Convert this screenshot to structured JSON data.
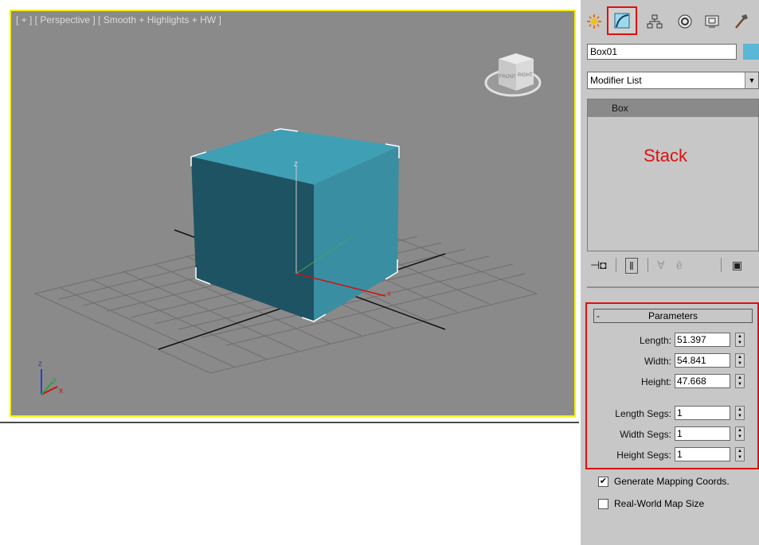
{
  "viewport": {
    "label": "[ + ] [ Perspective ] [ Smooth + Highlights + HW ]",
    "viewcube": {
      "front": "FRONT",
      "right": "RIGHT"
    },
    "axes": {
      "x": "x",
      "y": "y",
      "z": "z"
    },
    "colors": {
      "background": "#8a8a8a",
      "border": "#f6f000",
      "box_top": "#3f9fb5",
      "box_front": "#1e5363",
      "box_side": "#3a8ea2"
    }
  },
  "command_panel": {
    "tabs": [
      {
        "name": "create",
        "icon": "sun-star-icon"
      },
      {
        "name": "modify",
        "icon": "curve-modify-icon",
        "active": true
      },
      {
        "name": "hierarchy",
        "icon": "hierarchy-icon"
      },
      {
        "name": "motion",
        "icon": "motion-icon"
      },
      {
        "name": "display",
        "icon": "display-icon"
      },
      {
        "name": "utilities",
        "icon": "hammer-icon"
      }
    ],
    "object_name": "Box01",
    "object_color": "#5ab7d6",
    "modifier_list": "Modifier List",
    "stack_items": [
      "Box"
    ],
    "stack_annotation": "Stack",
    "stack_tools": [
      "pin-stack-icon",
      "show-end-result-icon",
      "make-unique-icon",
      "remove-modifier-icon",
      "configure-modifier-sets-icon"
    ],
    "parameters": {
      "title": "Parameters",
      "collapse": "-",
      "rows": [
        {
          "label": "Length:",
          "value": "51.397"
        },
        {
          "label": "Width:",
          "value": "54.841"
        },
        {
          "label": "Height:",
          "value": "47.668"
        },
        {
          "label": "Length Segs:",
          "value": "1"
        },
        {
          "label": "Width Segs:",
          "value": "1"
        },
        {
          "label": "Height Segs:",
          "value": "1"
        }
      ]
    },
    "checkboxes": [
      {
        "label": "Generate Mapping Coords.",
        "checked": true,
        "mark": "✔"
      },
      {
        "label": "Real-World Map Size",
        "checked": false,
        "mark": ""
      }
    ]
  }
}
